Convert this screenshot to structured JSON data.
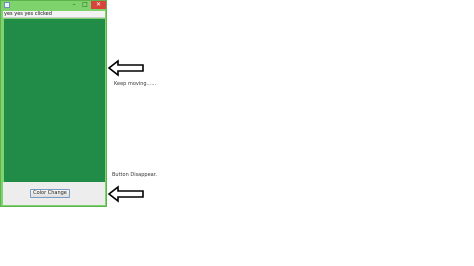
{
  "window": {
    "minimize_glyph": "–",
    "maximize_glyph": "□",
    "close_glyph": "✕",
    "status_label": "yes yes yes clicked",
    "panel_color": "#218c47",
    "titlebar_color": "#7ed36c",
    "close_color": "#d9443a"
  },
  "controls": {
    "color_change_label": "Color Change"
  },
  "annotations": {
    "keep_moving": "Keep moving......",
    "button_disappear": "Button Disappear."
  }
}
